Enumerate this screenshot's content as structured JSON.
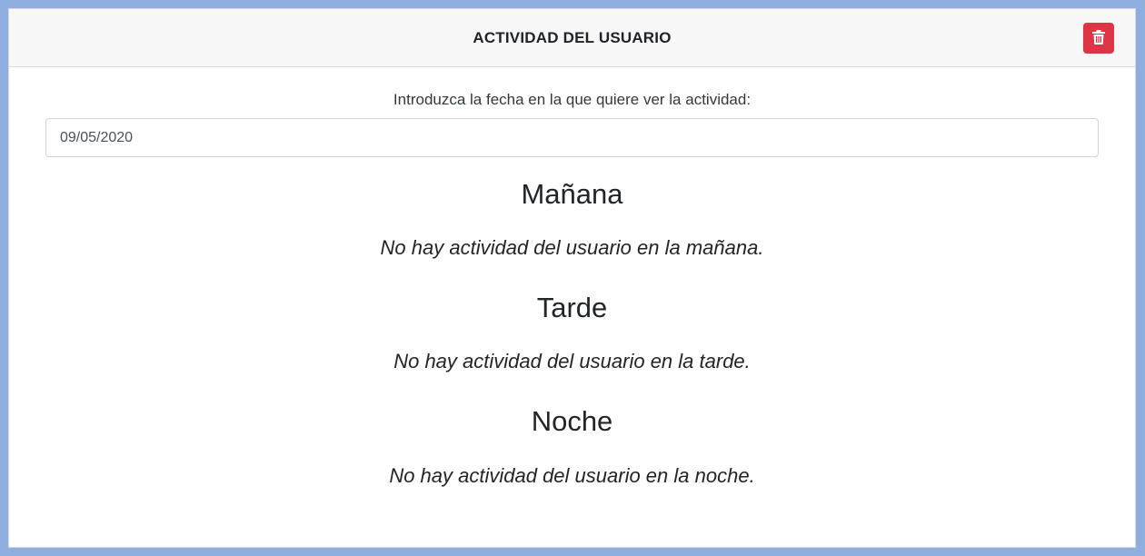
{
  "header": {
    "title": "ACTIVIDAD DEL USUARIO",
    "delete_icon": "trash-icon"
  },
  "form": {
    "date_label": "Introduzca la fecha en la que quiere ver la actividad:",
    "date_value": "09/05/2020"
  },
  "sections": [
    {
      "title": "Mañana",
      "message": "No hay actividad del usuario en la mañana."
    },
    {
      "title": "Tarde",
      "message": "No hay actividad del usuario en la tarde."
    },
    {
      "title": "Noche",
      "message": "No hay actividad del usuario en la noche."
    }
  ],
  "colors": {
    "page_border": "#8eaee0",
    "delete_button": "#dc3545"
  }
}
